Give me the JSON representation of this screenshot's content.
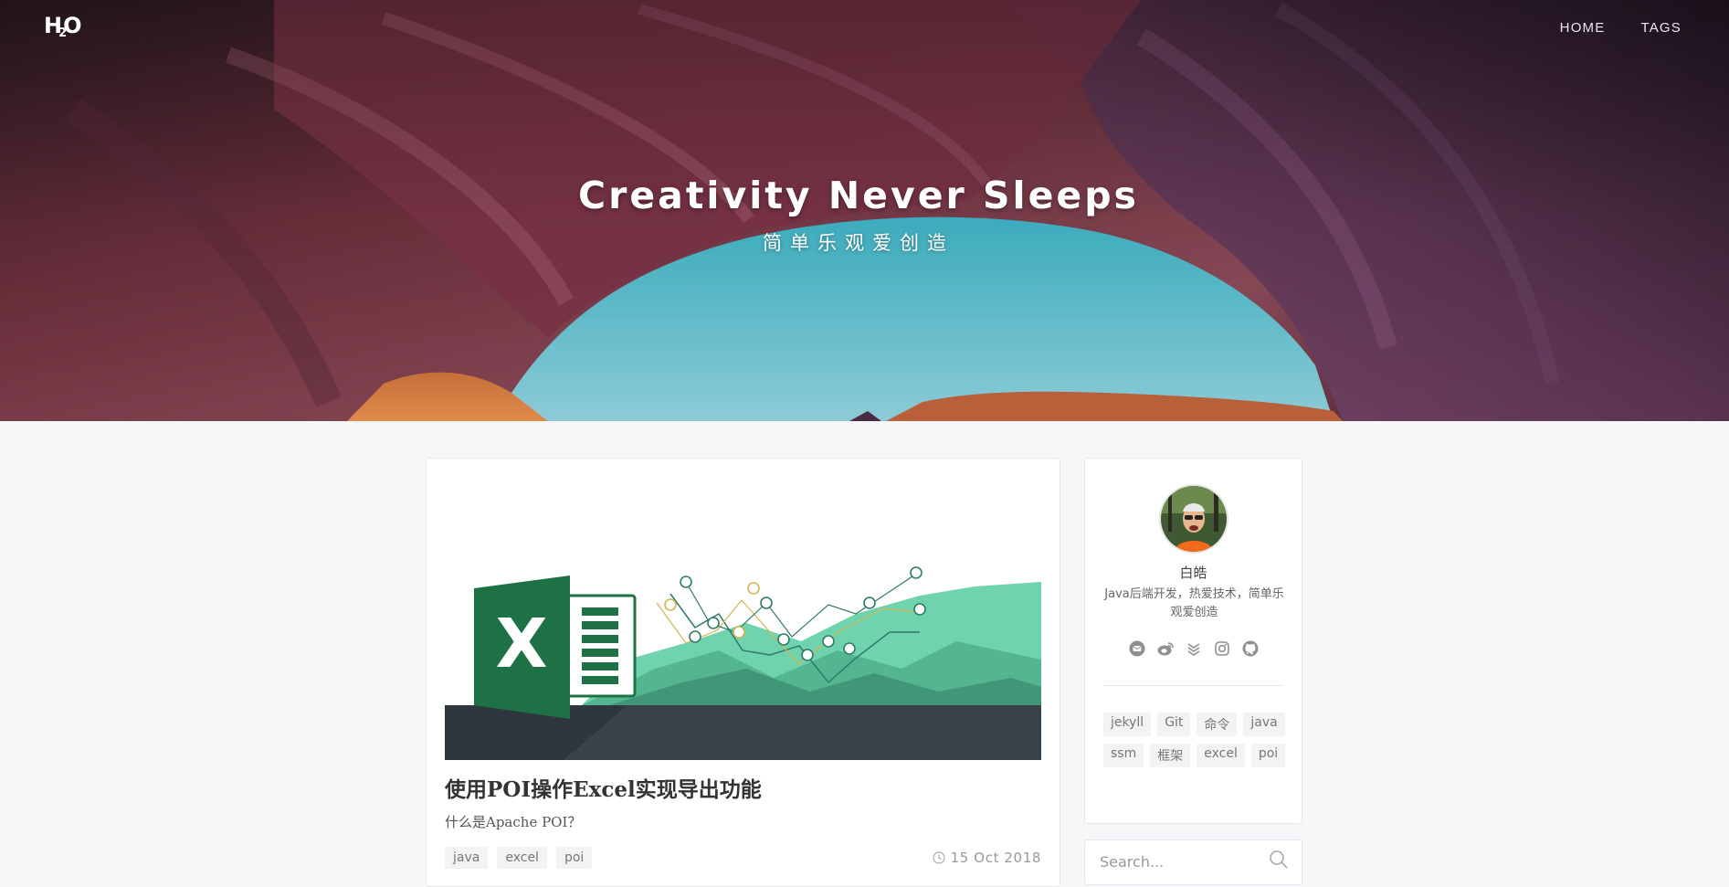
{
  "header": {
    "logo_main": "H",
    "logo_sub": "2",
    "logo_tail": "O",
    "nav": [
      {
        "label": "HOME"
      },
      {
        "label": "TAGS"
      }
    ],
    "title": "Creativity Never Sleeps",
    "subtitle": "简单乐观爱创造"
  },
  "post": {
    "image_icon": "excel-chart-illustration",
    "image_letter": "X",
    "title": "使用POI操作Excel实现导出功能",
    "excerpt": "什么是Apache POI？",
    "tags": [
      "java",
      "excel",
      "poi"
    ],
    "date": "15 Oct 2018"
  },
  "sidebar": {
    "author": "白皓",
    "bio": "Java后端开发，热爱技术，简单乐观爱创造",
    "social_icons": [
      "email-icon",
      "weibo-icon",
      "zhihu-icon",
      "instagram-icon",
      "github-icon"
    ],
    "tags": [
      "jekyll",
      "Git",
      "命令",
      "java",
      "ssm",
      "框架",
      "excel",
      "poi"
    ],
    "search_placeholder": "Search..."
  },
  "colors": {
    "excel_green": "#1e7145",
    "chart_green": "#5bcfa2",
    "ground": "#3a434b",
    "sky": "#57b9c9"
  }
}
